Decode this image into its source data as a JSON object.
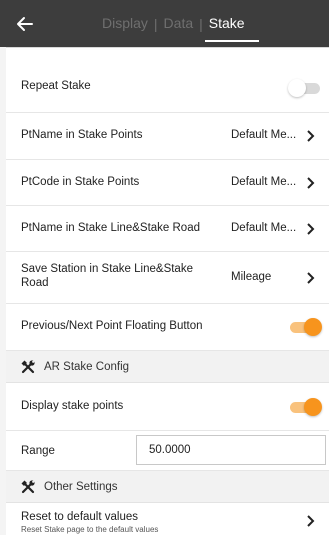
{
  "colors": {
    "header_bg": "#3d3d3d",
    "accent": "#f7941d",
    "toggle_on_track": "#f9c27d",
    "toggle_off_track": "#d9d9d9"
  },
  "header": {
    "back_icon": "arrow-left-icon",
    "tabs": [
      {
        "label": "Display",
        "active": false
      },
      {
        "label": "Data",
        "active": false
      },
      {
        "label": "Stake",
        "active": true
      }
    ]
  },
  "rows": {
    "repeat_stake": {
      "label": "Repeat Stake",
      "on": false
    },
    "ptname_points": {
      "label": "PtName in Stake Points",
      "value": "Default Me..."
    },
    "ptcode_points": {
      "label": "PtCode in Stake Points",
      "value": "Default Me..."
    },
    "ptname_line": {
      "label": "PtName in Stake Line&Stake Road",
      "value": "Default Me..."
    },
    "save_station": {
      "label_line1": "Save Station in Stake Line&Stake",
      "label_line2": "Road",
      "value": "Mileage"
    },
    "prev_next": {
      "label": "Previous/Next Point Floating Button",
      "on": true
    }
  },
  "ar_section": {
    "title": "AR Stake Config",
    "icon": "tools-icon",
    "display_points": {
      "label": "Display stake points",
      "on": true
    },
    "range": {
      "label": "Range",
      "value": "50.0000"
    }
  },
  "other_section": {
    "title": "Other Settings",
    "icon": "tools-icon",
    "reset": {
      "label": "Reset to default values",
      "sublabel": "Reset Stake page to the default values"
    }
  }
}
